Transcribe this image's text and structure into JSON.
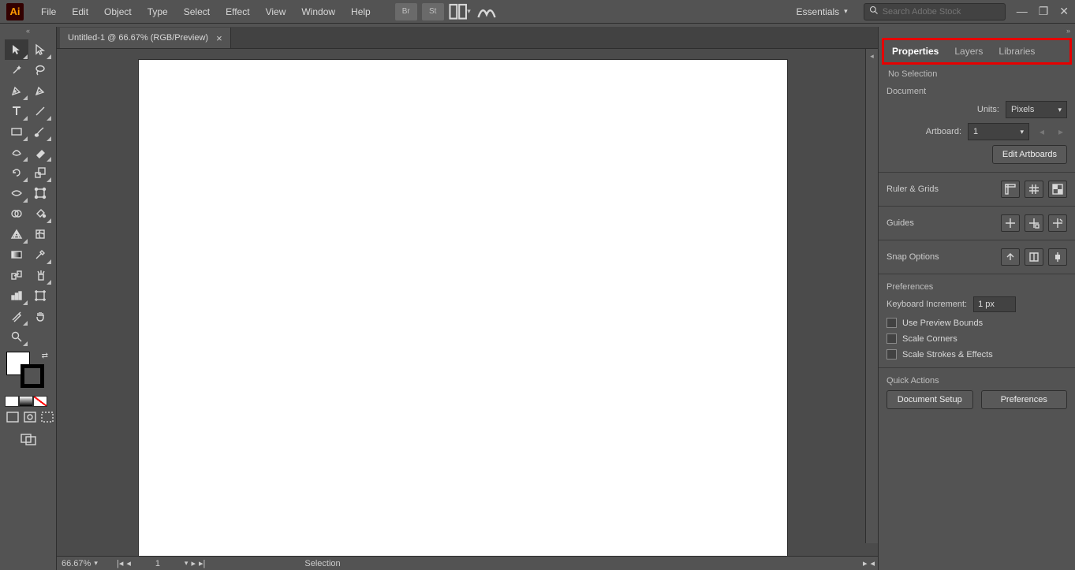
{
  "app": {
    "logo": "Ai"
  },
  "menu": [
    "File",
    "Edit",
    "Object",
    "Type",
    "Select",
    "Effect",
    "View",
    "Window",
    "Help"
  ],
  "workspace": "Essentials",
  "search_placeholder": "Search Adobe Stock",
  "document_tab": {
    "title": "Untitled-1 @ 66.67% (RGB/Preview)"
  },
  "status": {
    "zoom": "66.67%",
    "artboard": "1",
    "mode": "Selection"
  },
  "panel": {
    "tabs": {
      "properties": "Properties",
      "layers": "Layers",
      "libraries": "Libraries"
    },
    "no_selection": "No Selection",
    "document_section": "Document",
    "units_label": "Units:",
    "units_value": "Pixels",
    "artboard_label": "Artboard:",
    "artboard_value": "1",
    "edit_artboards": "Edit Artboards",
    "ruler_grids": "Ruler & Grids",
    "guides": "Guides",
    "snap_options": "Snap Options",
    "preferences_section": "Preferences",
    "keyboard_increment_label": "Keyboard Increment:",
    "keyboard_increment_value": "1 px",
    "use_preview_bounds": "Use Preview Bounds",
    "scale_corners": "Scale Corners",
    "scale_strokes": "Scale Strokes & Effects",
    "quick_actions": "Quick Actions",
    "document_setup": "Document Setup",
    "preferences_btn": "Preferences"
  }
}
